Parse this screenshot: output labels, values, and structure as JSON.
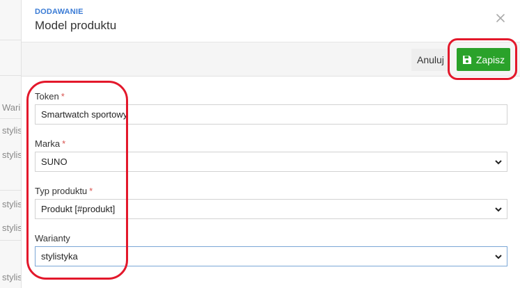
{
  "background": {
    "items": [
      "Wari",
      "stylis",
      "stylis",
      "stylis",
      "stylis",
      "stylis"
    ]
  },
  "modal": {
    "kicker": "DODAWANIE",
    "title": "Model produktu",
    "close_icon": "close-icon"
  },
  "toolbar": {
    "cancel_label": "Anuluj",
    "save_label": "Zapisz",
    "save_icon": "floppy-disk-icon",
    "save_color": "#2aa22a"
  },
  "fields": {
    "token": {
      "label": "Token",
      "required_mark": "*",
      "value": "Smartwatch sportowy"
    },
    "marka": {
      "label": "Marka",
      "required_mark": "*",
      "value": "SUNO"
    },
    "typ": {
      "label": "Typ produktu",
      "required_mark": "*",
      "value": "Produkt [#produkt]"
    },
    "warianty": {
      "label": "Warianty",
      "value": "stylistyka"
    }
  },
  "annotation_color": "#e3182b"
}
